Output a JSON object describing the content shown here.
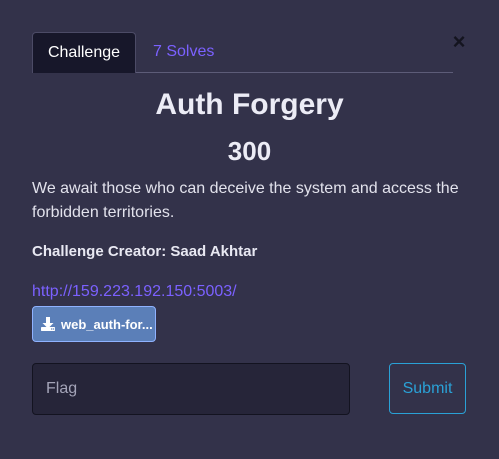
{
  "tabs": {
    "challenge_label": "Challenge",
    "solves_label": "7 Solves"
  },
  "close_symbol": "×",
  "challenge": {
    "title": "Auth Forgery",
    "points": "300",
    "description": "We await those who can deceive the system and access the forbidden territories.",
    "creator": "Challenge Creator: Saad Akhtar",
    "link": "http://159.223.192.150:5003/",
    "file_label": "web_auth-for..."
  },
  "flag": {
    "placeholder": "Flag",
    "value": ""
  },
  "submit_label": "Submit",
  "colors": {
    "background": "#33324a",
    "accent_link": "#7b61ff",
    "submit": "#2aa1d6",
    "file_button": "#5b7fb8"
  },
  "icons": {
    "close": "close-icon",
    "download": "download-icon"
  }
}
